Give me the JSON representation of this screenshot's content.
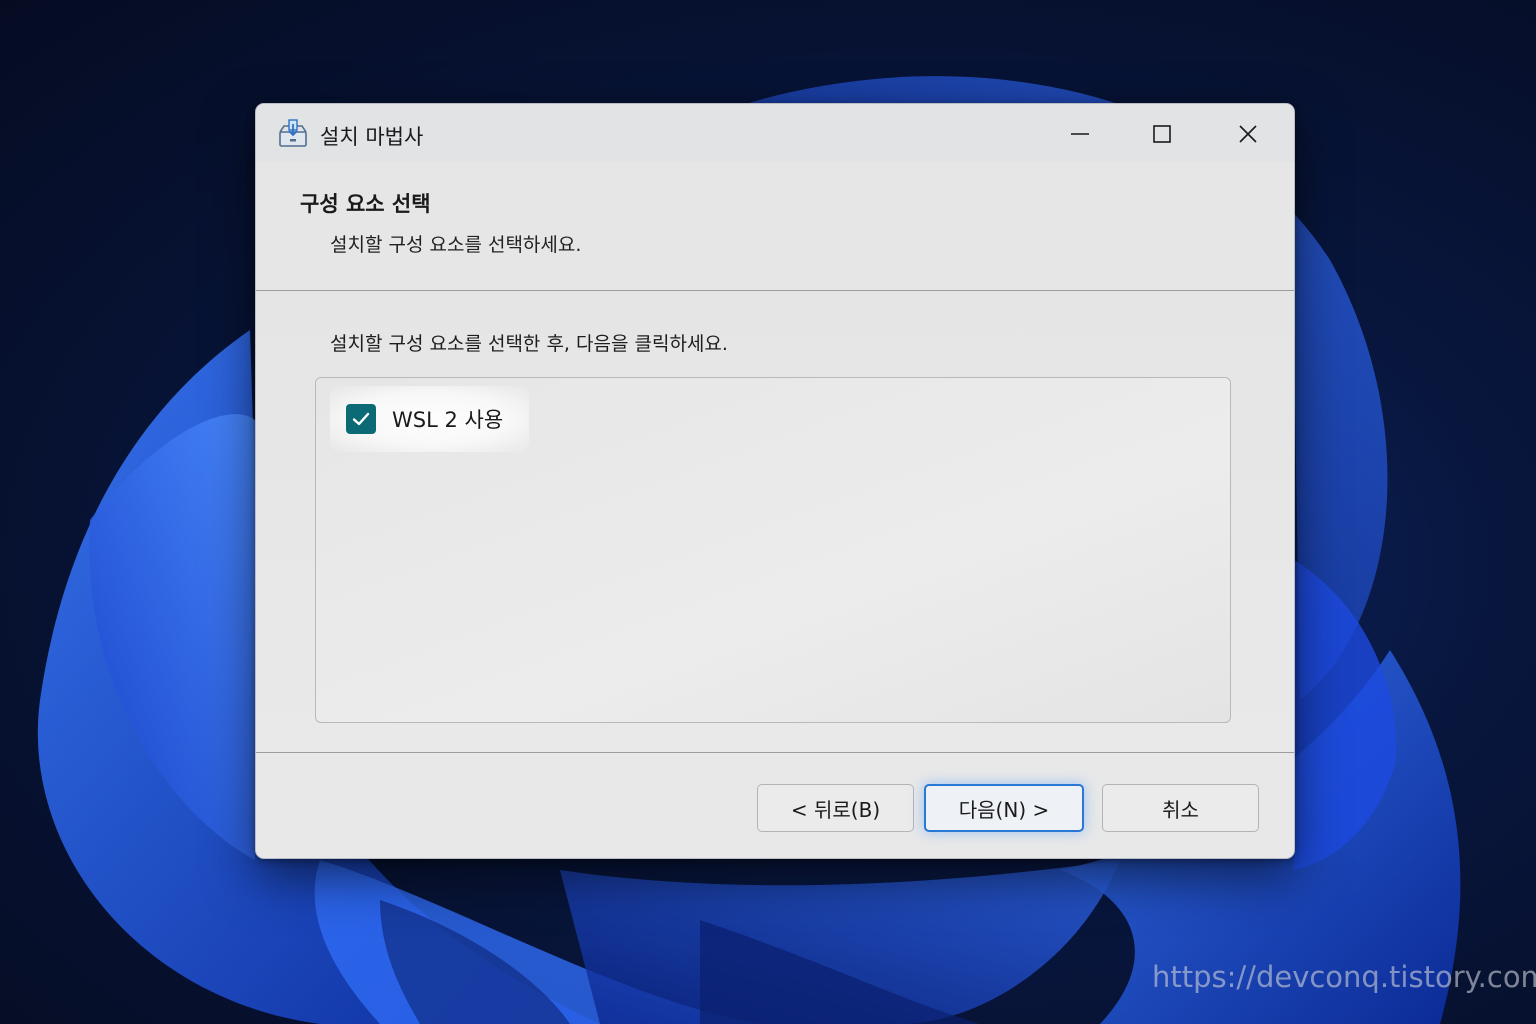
{
  "window": {
    "title": "설치 마법사",
    "icon": "installer-box-icon",
    "controls": {
      "minimize_icon": "minimize-icon",
      "maximize_icon": "maximize-icon",
      "close_icon": "close-icon"
    }
  },
  "header": {
    "title": "구성 요소 선택",
    "subtitle": "설치할 구성 요소를 선택하세요."
  },
  "body": {
    "instruction": "설치할 구성 요소를 선택한 후, 다음을 클릭하세요.",
    "components": [
      {
        "label": "WSL 2 사용",
        "checked": true
      }
    ]
  },
  "footer": {
    "back_label": "< 뒤로(B)",
    "next_label": "다음(N) >",
    "cancel_label": "취소"
  },
  "watermark": "https://devconq.tistory.com",
  "colors": {
    "checkbox_accent": "#0b6a75",
    "focus_border": "#2a77d4",
    "wallpaper_blue": "#1f4fd6"
  }
}
